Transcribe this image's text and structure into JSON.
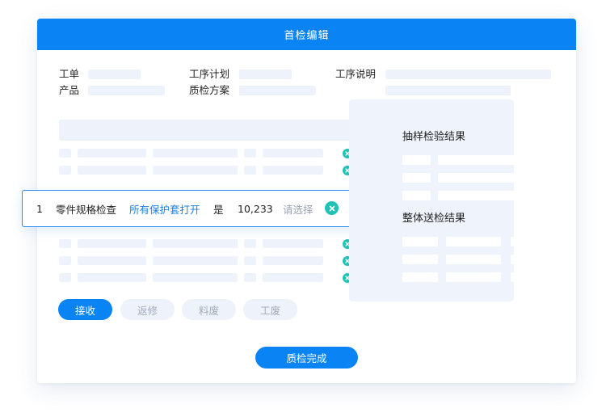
{
  "dialog": {
    "title": "首检编辑"
  },
  "form": {
    "work_order_label": "工单",
    "process_plan_label": "工序计划",
    "process_desc_label": "工序说明",
    "product_label": "产品",
    "inspection_plan_label": "质检方案"
  },
  "right_panel": {
    "sampling_result_title": "抽样检验结果",
    "overall_result_title": "整体送检结果"
  },
  "highlight_row": {
    "index": "1",
    "item": "零件规格检查",
    "requirement": "所有保护套打开",
    "judgement": "是",
    "value": "10,233",
    "select_placeholder": "请选择"
  },
  "actions": {
    "accept": "接收",
    "rework": "返修",
    "material_scrap": "料废",
    "work_scrap": "工废",
    "finish": "质检完成"
  },
  "icons": {
    "reject": "close-icon",
    "approve": "check-icon"
  },
  "colors": {
    "primary": "#0a84f4",
    "teal": "#1fc3b6",
    "placeholder": "#eef2fb",
    "panel": "#eff3fb"
  }
}
